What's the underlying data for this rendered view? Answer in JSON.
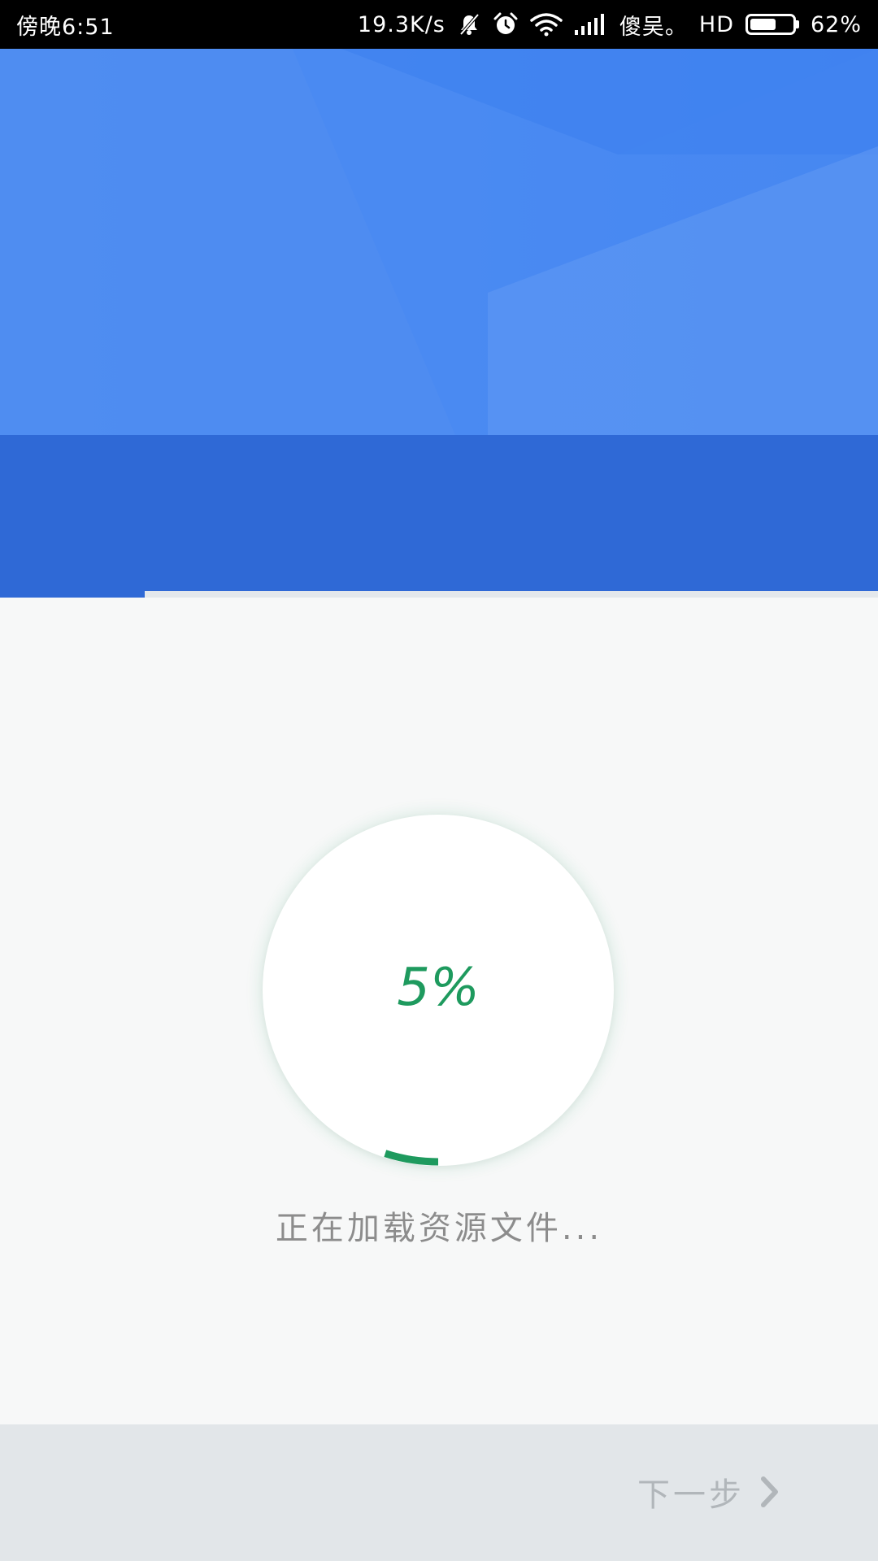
{
  "status_bar": {
    "time": "傍晚6:51",
    "net_speed": "19.3K/s",
    "carrier": "傻吴。",
    "hd": "HD",
    "battery_percent": "62%",
    "battery_level": 0.62,
    "icons": [
      "mute-bell-icon",
      "alarm-icon",
      "wifi-icon",
      "signal-icon",
      "battery-icon"
    ]
  },
  "banner": {
    "colors": {
      "top": "#4689f1",
      "bottom": "#2f69d6"
    },
    "progress_fraction": 0.165
  },
  "loader": {
    "percent_label": "5%",
    "progress": 0.05,
    "accent_color": "#1e9a5e",
    "status_text": "正在加载资源文件..."
  },
  "footer": {
    "next_label": "下一步",
    "next_icon": "chevron-right-icon",
    "text_color": "#b1b6ba"
  }
}
